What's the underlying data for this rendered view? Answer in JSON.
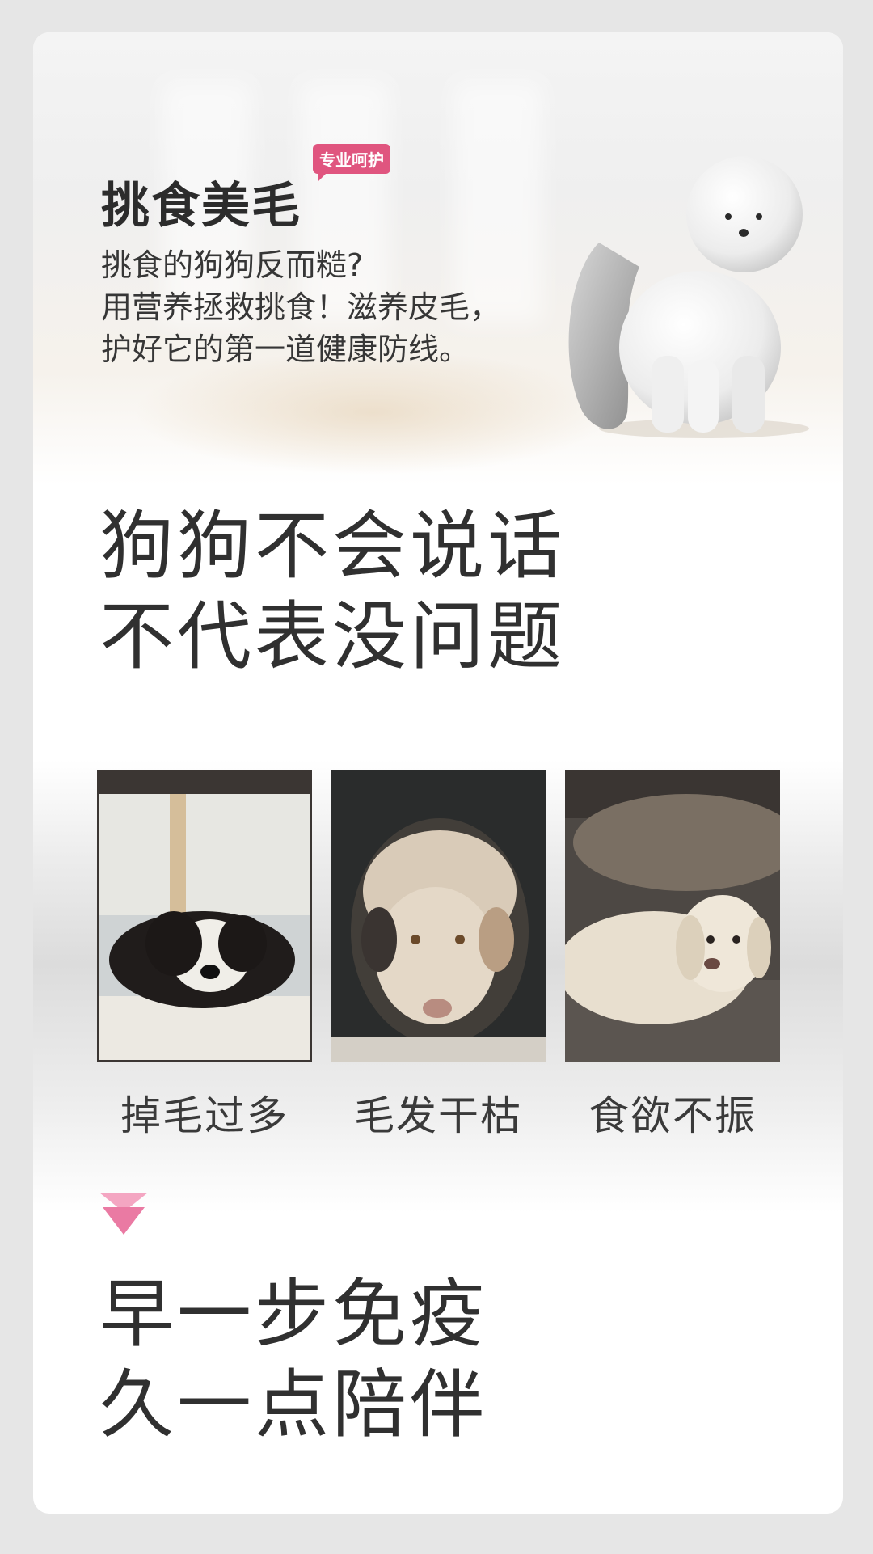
{
  "hero": {
    "title": "挑食美毛",
    "badge": "专业呵护",
    "lines": [
      "挑食的狗狗反而糙?",
      "用营养拯救挑食！滋养皮毛，",
      "护好它的第一道健康防线。"
    ]
  },
  "headline1": [
    "狗狗不会说话",
    "不代表没问题"
  ],
  "photos": [
    {
      "caption": "掉毛过多"
    },
    {
      "caption": "毛发干枯"
    },
    {
      "caption": "食欲不振"
    }
  ],
  "headline2": [
    "早一步免疫",
    "久一点陪伴"
  ],
  "colors": {
    "accent": "#e0557f",
    "arrow": "#ee8fb0",
    "text": "#2f2f2f"
  }
}
